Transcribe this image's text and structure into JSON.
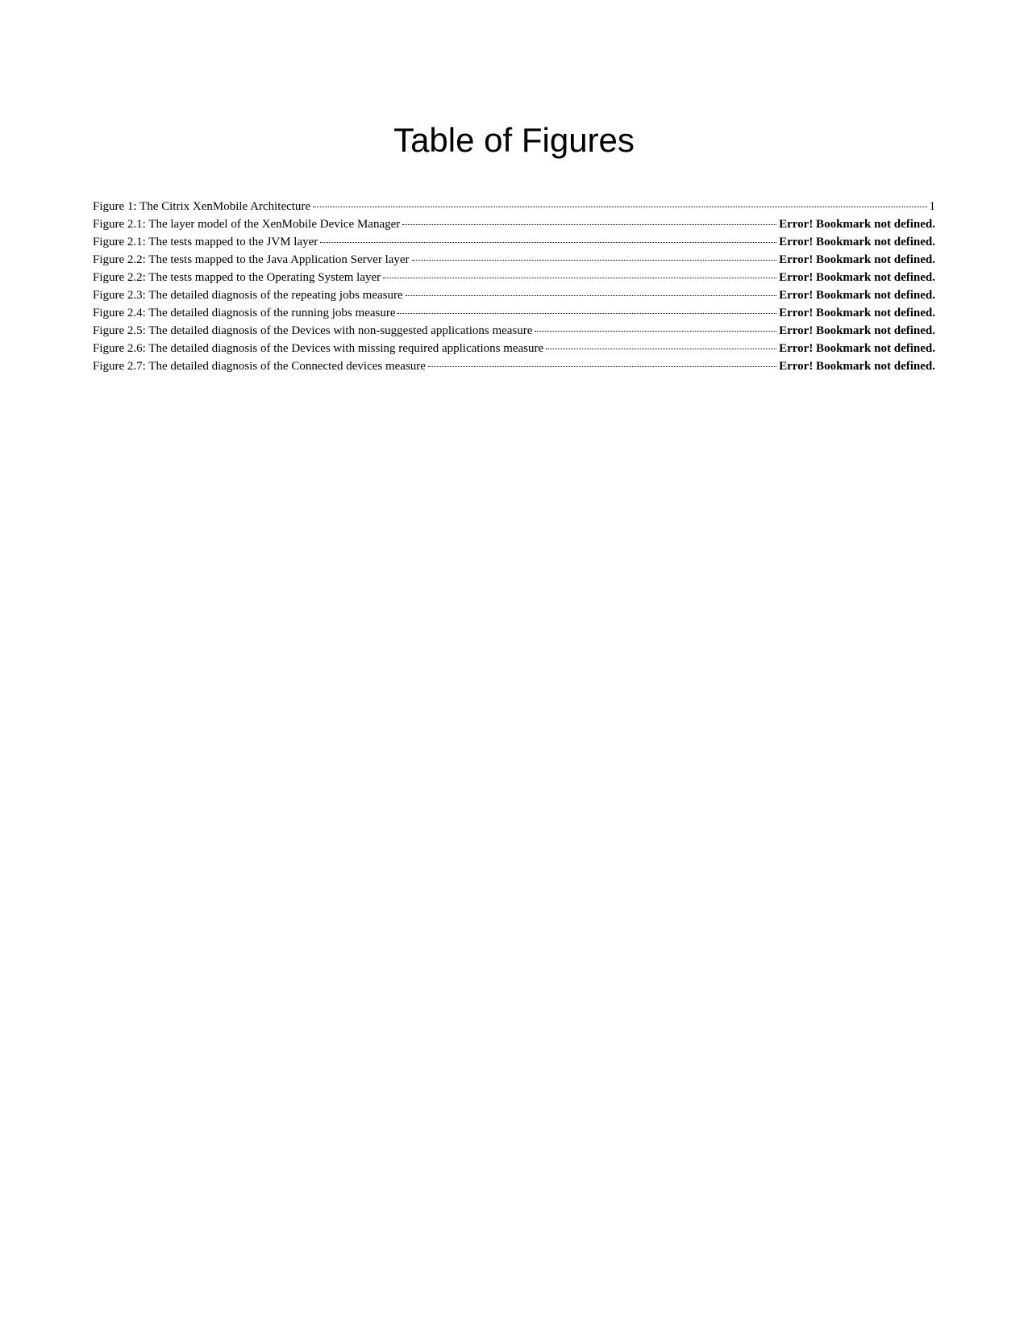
{
  "title": "Table of Figures",
  "entries": [
    {
      "label": "Figure 1: The Citrix XenMobile Architecture",
      "page": "1",
      "bold": false
    },
    {
      "label": "Figure 2.1: The layer model of the XenMobile Device Manager",
      "page": "Error! Bookmark not defined.",
      "bold": true
    },
    {
      "label": "Figure 2.1: The tests mapped to the JVM layer",
      "page": "Error! Bookmark not defined.",
      "bold": true
    },
    {
      "label": "Figure 2.2: The tests mapped to the Java Application Server layer",
      "page": "Error! Bookmark not defined.",
      "bold": true
    },
    {
      "label": "Figure 2.2: The tests mapped to the Operating System layer",
      "page": "Error! Bookmark not defined.",
      "bold": true
    },
    {
      "label": "Figure 2.3: The detailed diagnosis of the repeating jobs measure",
      "page": "Error! Bookmark not defined.",
      "bold": true
    },
    {
      "label": "Figure 2.4: The detailed diagnosis of the running jobs measure",
      "page": "Error! Bookmark not defined.",
      "bold": true
    },
    {
      "label": "Figure 2.5: The detailed diagnosis of the Devices with non-suggested applications measure",
      "page": "Error! Bookmark not defined.",
      "bold": true
    },
    {
      "label": "Figure 2.6: The detailed diagnosis of the Devices with missing required applications measure",
      "page": "Error! Bookmark not defined.",
      "bold": true
    },
    {
      "label": "Figure 2.7: The detailed diagnosis of the Connected devices measure",
      "page": "Error! Bookmark not defined.",
      "bold": true
    }
  ]
}
